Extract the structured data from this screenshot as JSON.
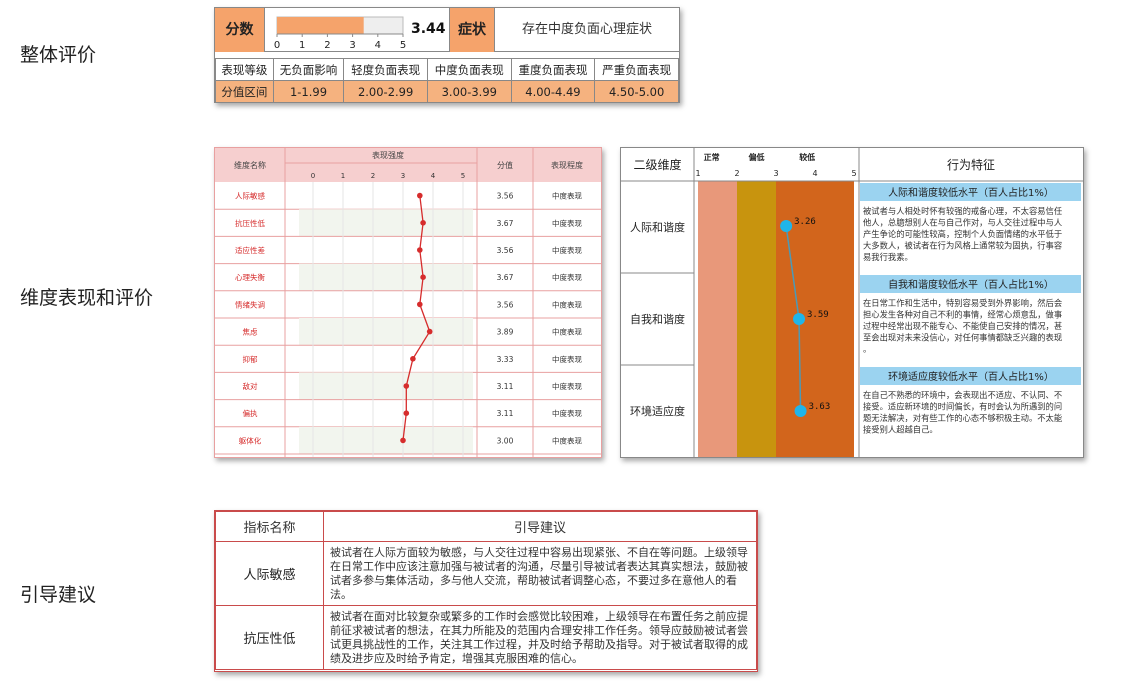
{
  "sections": {
    "overall": "整体评价",
    "dimension": "维度表现和评价",
    "guidance": "引导建议"
  },
  "overall": {
    "score_label": "分数",
    "score": 3.44,
    "score_text": "3.44",
    "scale_ticks": [
      "0",
      "1",
      "2",
      "3",
      "4",
      "5"
    ],
    "symptom_label": "症状",
    "symptom_text": "存在中度负面心理症状",
    "levels_header": [
      "表现等级",
      "无负面影响",
      "轻度负面表现",
      "中度负面表现",
      "重度负面表现",
      "严重负面表现"
    ],
    "levels_range": [
      "分值区间",
      "1-1.99",
      "2.00-2.99",
      "3.00-3.99",
      "4.00-4.49",
      "4.50-5.00"
    ],
    "colors": {
      "accent": "#f5a36b",
      "range_row": "#f5b27f"
    }
  },
  "dimension_chart": {
    "headers": {
      "name": "维度名称",
      "strength": "表现强度",
      "score": "分值",
      "level": "表现程度"
    },
    "x_ticks": [
      "0",
      "1",
      "2",
      "3",
      "4",
      "5"
    ],
    "colors": {
      "line": "#d62c2c",
      "header_bg": "#f6cfcf",
      "label": "#d62c2c"
    }
  },
  "chart_data": [
    {
      "type": "line",
      "categories": [
        "人际敏感",
        "抗压性低",
        "适应性差",
        "心理失衡",
        "情绪失调",
        "焦虑",
        "抑郁",
        "敌对",
        "偏执",
        "躯体化"
      ],
      "values": [
        3.56,
        3.67,
        3.56,
        3.67,
        3.56,
        3.89,
        3.33,
        3.11,
        3.11,
        3.0
      ],
      "value_labels": [
        "3.56",
        "3.67",
        "3.56",
        "3.67",
        "3.56",
        "3.89",
        "3.33",
        "3.11",
        "3.11",
        "3.00"
      ],
      "levels": [
        "中度表现",
        "中度表现",
        "中度表现",
        "中度表现",
        "中度表现",
        "中度表现",
        "中度表现",
        "中度表现",
        "中度表现",
        "中度表现"
      ],
      "xlim": [
        0,
        5
      ]
    },
    {
      "type": "line",
      "categories": [
        "人际和谐度",
        "自我和谐度",
        "环境适应度"
      ],
      "values": [
        3.26,
        3.59,
        3.63
      ],
      "value_labels": [
        "3.26",
        "3.59",
        "3.63"
      ],
      "xlim": [
        1,
        5
      ],
      "bands": [
        {
          "label": "正常",
          "from": 1,
          "to": 2,
          "color": "#e8987a"
        },
        {
          "label": "偏低",
          "from": 2,
          "to": 3,
          "color": "#c8940e"
        },
        {
          "label": "较低",
          "from": 3,
          "to": 5,
          "color": "#d2651c"
        }
      ]
    }
  ],
  "secondary": {
    "header_dim": "二级维度",
    "header_feature": "行为特征",
    "x_ticks": [
      "1",
      "2",
      "3",
      "4",
      "5"
    ],
    "items": [
      {
        "name": "人际和谐度",
        "title": "人际和谐度较低水平（百人占比1%）",
        "text": "被试者与人相处时怀有较强的戒备心理，不太容易信任他人，总臆想别人在与自己作对，与人交往过程中与人产生争论的可能性较高，控制个人负面情绪的水平低于大多数人，被试者在行为风格上通常较为固执，行事容易我行我素。"
      },
      {
        "name": "自我和谐度",
        "title": "自我和谐度较低水平（百人占比1%）",
        "text": "在日常工作和生活中，特别容易受到外界影响，然后会担心发生各种对自己不利的事情，经常心烦意乱，做事过程中经常出现不能专心、不能使自己安排的情况，甚至会出现对未来没信心，对任何事情都缺乏兴趣的表现。"
      },
      {
        "name": "环境适应度",
        "title": "环境适应度较低水平（百人占比1%）",
        "text": "在自己不熟悉的环境中，会表现出不适应、不认同、不接受。适应新环境的时间偏长，有时会认为所遇到的问题无法解决，对有些工作的心态不够积极主动。不太能接受别人超越自己。"
      }
    ],
    "colors": {
      "title_bg": "#9bd3f0",
      "line": "#4a9ab8",
      "dot": "#1fb5ea"
    }
  },
  "guidance": {
    "header_name": "指标名称",
    "header_advice": "引导建议",
    "rows": [
      {
        "name": "人际敏感",
        "text": "被试者在人际方面较为敏感，与人交往过程中容易出现紧张、不自在等问题。上级领导在日常工作中应该注意加强与被试者的沟通，尽量引导被试者表达其真实想法，鼓励被试者多参与集体活动，多与他人交流，帮助被试者调整心态，不要过多在意他人的看法。"
      },
      {
        "name": "抗压性低",
        "text": "被试者在面对比较复杂或繁多的工作时会感觉比较困难，上级领导在布置任务之前应提前征求被试者的想法，在其力所能及的范围内合理安排工作任务。领导应鼓励被试者尝试更具挑战性的工作，关注其工作过程，并及时给予帮助及指导。对于被试者取得的成绩及进步应及时给予肯定，增强其克服困难的信心。"
      }
    ]
  }
}
